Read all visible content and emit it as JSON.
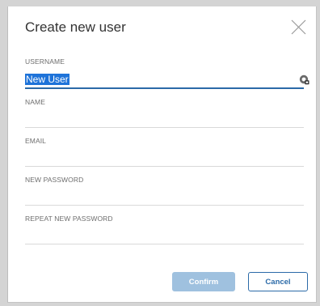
{
  "dialog": {
    "title": "Create new user",
    "close_icon": "close-icon"
  },
  "fields": {
    "username": {
      "label": "USERNAME",
      "value": "New User",
      "icon": "password-manager-icon"
    },
    "name": {
      "label": "NAME",
      "value": ""
    },
    "email": {
      "label": "EMAIL",
      "value": ""
    },
    "new_password": {
      "label": "NEW PASSWORD",
      "value": ""
    },
    "repeat_password": {
      "label": "REPEAT NEW PASSWORD",
      "value": ""
    }
  },
  "buttons": {
    "confirm_label": "Confirm",
    "cancel_label": "Cancel"
  },
  "colors": {
    "accent": "#2b6aa8",
    "confirm_disabled": "#9fc1df",
    "selection": "#1e73d9"
  }
}
